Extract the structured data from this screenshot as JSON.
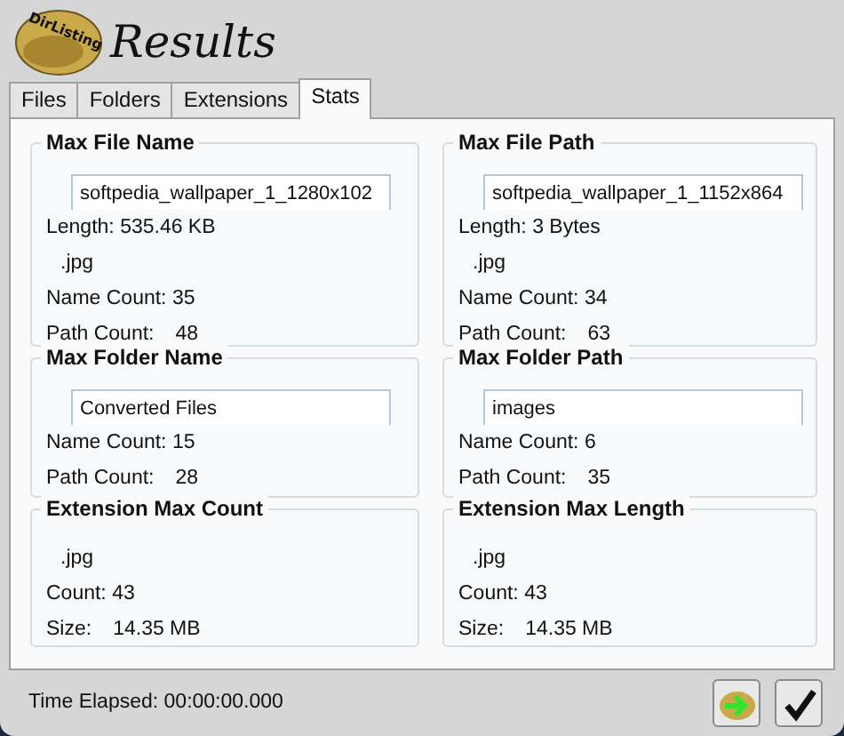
{
  "window": {
    "title": "Results",
    "logo_text": "DirListing"
  },
  "tabs": [
    {
      "label": "Files",
      "selected": false
    },
    {
      "label": "Folders",
      "selected": false
    },
    {
      "label": "Extensions",
      "selected": false
    },
    {
      "label": "Stats",
      "selected": true
    }
  ],
  "groups": [
    {
      "title": "Max File Name",
      "field_value": "softpedia_wallpaper_1_1280x102",
      "lines": [
        {
          "kind": "text",
          "text": "Length: 535.46 KB"
        },
        {
          "kind": "ext",
          "text": ".jpg"
        },
        {
          "kind": "text",
          "text": "Name Count: 35"
        },
        {
          "kind": "pair",
          "label": "Path Count:",
          "value": "48"
        }
      ]
    },
    {
      "title": "Max File Path",
      "field_value": "softpedia_wallpaper_1_1152x864",
      "lines": [
        {
          "kind": "text",
          "text": "Length: 3 Bytes"
        },
        {
          "kind": "ext",
          "text": ".jpg"
        },
        {
          "kind": "text",
          "text": "Name Count: 34"
        },
        {
          "kind": "pair",
          "label": "Path Count:",
          "value": "63"
        }
      ]
    },
    {
      "title": "Max Folder Name",
      "field_value": "Converted Files",
      "lines": [
        {
          "kind": "text",
          "text": "Name Count: 15"
        },
        {
          "kind": "pair",
          "label": "Path Count:",
          "value": "28"
        }
      ]
    },
    {
      "title": "Max Folder Path",
      "field_value": "images",
      "lines": [
        {
          "kind": "text",
          "text": "Name Count: 6"
        },
        {
          "kind": "pair",
          "label": "Path Count:",
          "value": "35"
        }
      ]
    },
    {
      "title": "Extension Max Count",
      "lines": [
        {
          "kind": "ext",
          "text": ".jpg"
        },
        {
          "kind": "text",
          "text": "Count: 43"
        },
        {
          "kind": "pair",
          "label": "Size:",
          "value": "14.35 MB"
        }
      ]
    },
    {
      "title": "Extension Max Length",
      "lines": [
        {
          "kind": "ext",
          "text": ".jpg"
        },
        {
          "kind": "text",
          "text": "Count: 43"
        },
        {
          "kind": "pair",
          "label": "Size:",
          "value": "14.35 MB"
        }
      ]
    }
  ],
  "status_bar": {
    "text": "Time Elapsed: 00:00:00.000"
  }
}
